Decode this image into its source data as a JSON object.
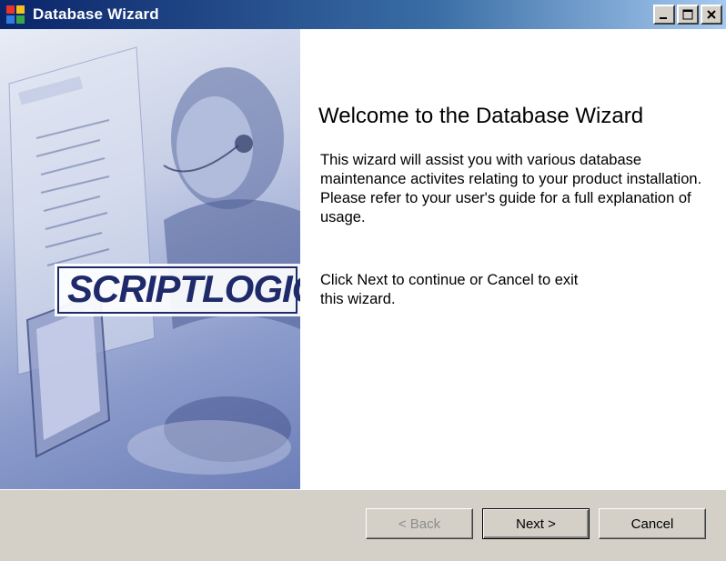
{
  "window": {
    "title": "Database Wizard"
  },
  "banner": {
    "logo_text": "SCRIPTLOGIC"
  },
  "content": {
    "heading": "Welcome to the Database Wizard",
    "description": "This wizard will assist you with various database maintenance activites relating to your product installation.  Please refer to your user's guide for a full explanation of usage.",
    "instruction": "Click Next to continue or Cancel to exit this wizard."
  },
  "buttons": {
    "back_label": "< Back",
    "next_label": "Next >",
    "cancel_label": "Cancel"
  },
  "colors": {
    "titlebar_start": "#0a246a",
    "titlebar_end": "#a6caf0",
    "dialog_face": "#d4d0c8",
    "content_bg": "#ffffff"
  }
}
